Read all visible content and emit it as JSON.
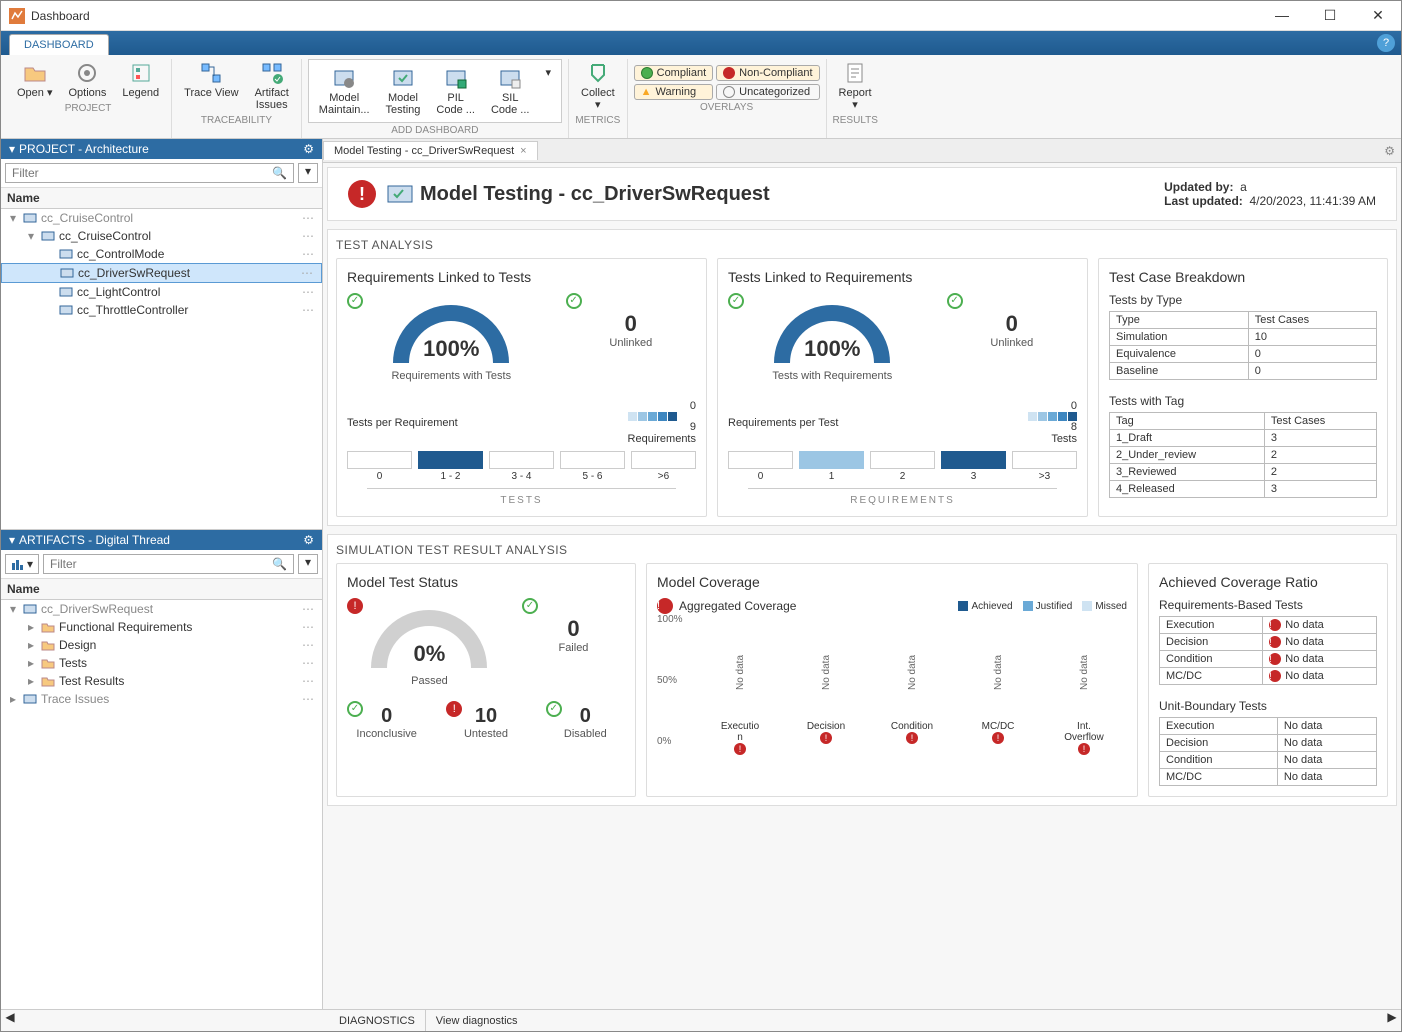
{
  "window": {
    "title": "Dashboard"
  },
  "ribbon": {
    "tab": "DASHBOARD",
    "groups": {
      "project": {
        "label": "PROJECT",
        "open": "Open",
        "options": "Options",
        "legend": "Legend"
      },
      "trace": {
        "label": "TRACEABILITY",
        "traceView": "Trace View",
        "artifactIssues": "Artifact\nIssues"
      },
      "addDash": {
        "label": "ADD DASHBOARD",
        "modelMaint": "Model\nMaintain...",
        "modelTesting": "Model\nTesting",
        "pil": "PIL\nCode ...",
        "sil": "SIL\nCode ..."
      },
      "metrics": {
        "label": "METRICS",
        "collect": "Collect"
      },
      "overlays": {
        "label": "OVERLAYS",
        "compliant": "Compliant",
        "nonCompliant": "Non-Compliant",
        "warning": "Warning",
        "uncategorized": "Uncategorized"
      },
      "results": {
        "label": "RESULTS",
        "report": "Report"
      }
    }
  },
  "projectPanel": {
    "title": "PROJECT - Architecture",
    "filterPlaceholder": "Filter",
    "colHeader": "Name",
    "tree": [
      {
        "label": "cc_CruiseControl",
        "depth": 0,
        "expanded": true,
        "sel": false
      },
      {
        "label": "cc_CruiseControl",
        "depth": 1,
        "expanded": true,
        "sel": false
      },
      {
        "label": "cc_ControlMode",
        "depth": 2,
        "sel": false
      },
      {
        "label": "cc_DriverSwRequest",
        "depth": 2,
        "sel": true
      },
      {
        "label": "cc_LightControl",
        "depth": 2,
        "sel": false
      },
      {
        "label": "cc_ThrottleController",
        "depth": 2,
        "sel": false
      }
    ]
  },
  "artifactsPanel": {
    "title": "ARTIFACTS - Digital Thread",
    "filterPlaceholder": "Filter",
    "colHeader": "Name",
    "tree": [
      {
        "label": "cc_DriverSwRequest",
        "depth": 0,
        "expanded": true
      },
      {
        "label": "Functional Requirements",
        "depth": 1,
        "expandable": true
      },
      {
        "label": "Design",
        "depth": 1,
        "expandable": true
      },
      {
        "label": "Tests",
        "depth": 1,
        "expandable": true
      },
      {
        "label": "Test Results",
        "depth": 1,
        "expandable": true
      },
      {
        "label": "Trace Issues",
        "depth": 0,
        "expandable": true
      }
    ]
  },
  "docTab": "Model Testing - cc_DriverSwRequest",
  "page": {
    "title": "Model Testing - cc_DriverSwRequest",
    "updatedByLbl": "Updated by:",
    "updatedBy": "a",
    "lastUpdatedLbl": "Last updated:",
    "lastUpdated": "4/20/2023, 11:41:39 AM"
  },
  "testAnalysis": {
    "title": "TEST ANALYSIS",
    "reqToTests": {
      "title": "Requirements Linked to Tests",
      "gaugeVal": "100%",
      "gaugeLbl": "Requirements with Tests",
      "unlinkedVal": "0",
      "unlinkedLbl": "Unlinked",
      "distTitle": "Tests per Requirement",
      "heatMin": "0",
      "heatMax": "9",
      "heatUnit": "Requirements",
      "bins": [
        "0",
        "1 - 2",
        "3 - 4",
        "5 - 6",
        ">6"
      ],
      "binHighlight": 1,
      "axis": "TESTS"
    },
    "testsToReq": {
      "title": "Tests Linked to Requirements",
      "gaugeVal": "100%",
      "gaugeLbl": "Tests with Requirements",
      "unlinkedVal": "0",
      "unlinkedLbl": "Unlinked",
      "distTitle": "Requirements per Test",
      "heatMin": "0",
      "heatMax": "8",
      "heatUnit": "Tests",
      "bins": [
        "0",
        "1",
        "2",
        "3",
        ">3"
      ],
      "binHighlight": 3,
      "binSecondary": 1,
      "axis": "REQUIREMENTS"
    },
    "breakdown": {
      "title": "Test Case Breakdown",
      "byTypeTitle": "Tests by Type",
      "byTypeCols": [
        "Type",
        "Test Cases"
      ],
      "byType": [
        [
          "Simulation",
          "10"
        ],
        [
          "Equivalence",
          "0"
        ],
        [
          "Baseline",
          "0"
        ]
      ],
      "withTagTitle": "Tests with Tag",
      "withTagCols": [
        "Tag",
        "Test Cases"
      ],
      "withTag": [
        [
          "1_Draft",
          "3"
        ],
        [
          "2_Under_review",
          "2"
        ],
        [
          "3_Reviewed",
          "2"
        ],
        [
          "4_Released",
          "3"
        ]
      ]
    }
  },
  "simAnalysis": {
    "title": "SIMULATION TEST RESULT ANALYSIS",
    "status": {
      "title": "Model Test Status",
      "gaugeVal": "0%",
      "gaugeLbl": "Passed",
      "cells": [
        {
          "val": "0",
          "lbl": "Failed",
          "icon": "ok"
        },
        {
          "val": "0",
          "lbl": "Inconclusive",
          "icon": "ok"
        },
        {
          "val": "10",
          "lbl": "Untested",
          "icon": "alert"
        },
        {
          "val": "0",
          "lbl": "Disabled",
          "icon": "ok"
        }
      ]
    },
    "coverage": {
      "title": "Model Coverage",
      "subtitle": "Aggregated Coverage",
      "legend": [
        "Achieved",
        "Justified",
        "Missed"
      ],
      "yTicks": [
        "100%",
        "50%",
        "0%"
      ],
      "cols": [
        "Executio\nn",
        "Decision",
        "Condition",
        "MC/DC",
        "Int.\nOverflow"
      ],
      "noData": "No data"
    },
    "ratio": {
      "title": "Achieved Coverage Ratio",
      "reqTitle": "Requirements-Based Tests",
      "unitTitle": "Unit-Boundary Tests",
      "rows": [
        "Execution",
        "Decision",
        "Condition",
        "MC/DC"
      ],
      "noData": "No data"
    }
  },
  "footer": {
    "diagnostics": "DIAGNOSTICS",
    "view": "View diagnostics"
  },
  "chart_data": [
    {
      "type": "gauge",
      "title": "Requirements with Tests",
      "value": 100,
      "unit": "%",
      "range": [
        0,
        100
      ]
    },
    {
      "type": "gauge",
      "title": "Tests with Requirements",
      "value": 100,
      "unit": "%",
      "range": [
        0,
        100
      ]
    },
    {
      "type": "gauge",
      "title": "Passed",
      "value": 0,
      "unit": "%",
      "range": [
        0,
        100
      ]
    },
    {
      "type": "bar",
      "title": "Tests per Requirement",
      "categories": [
        "0",
        "1-2",
        "3-4",
        "5-6",
        ">6"
      ],
      "values": [
        0,
        9,
        0,
        0,
        0
      ],
      "ylabel": "Requirements",
      "ylim": [
        0,
        9
      ]
    },
    {
      "type": "bar",
      "title": "Requirements per Test",
      "categories": [
        "0",
        "1",
        "2",
        "3",
        ">3"
      ],
      "values": [
        0,
        2,
        0,
        8,
        0
      ],
      "ylabel": "Tests",
      "ylim": [
        0,
        8
      ]
    },
    {
      "type": "table",
      "title": "Tests by Type",
      "columns": [
        "Type",
        "Test Cases"
      ],
      "rows": [
        [
          "Simulation",
          10
        ],
        [
          "Equivalence",
          0
        ],
        [
          "Baseline",
          0
        ]
      ]
    },
    {
      "type": "table",
      "title": "Tests with Tag",
      "columns": [
        "Tag",
        "Test Cases"
      ],
      "rows": [
        [
          "1_Draft",
          3
        ],
        [
          "2_Under_review",
          2
        ],
        [
          "3_Reviewed",
          2
        ],
        [
          "4_Released",
          3
        ]
      ]
    },
    {
      "type": "bar",
      "title": "Aggregated Coverage",
      "categories": [
        "Execution",
        "Decision",
        "Condition",
        "MC/DC",
        "Int. Overflow"
      ],
      "series": [
        {
          "name": "Achieved",
          "values": [
            null,
            null,
            null,
            null,
            null
          ]
        },
        {
          "name": "Justified",
          "values": [
            null,
            null,
            null,
            null,
            null
          ]
        },
        {
          "name": "Missed",
          "values": [
            null,
            null,
            null,
            null,
            null
          ]
        }
      ],
      "ylim": [
        0,
        100
      ],
      "ylabel": "%"
    }
  ]
}
